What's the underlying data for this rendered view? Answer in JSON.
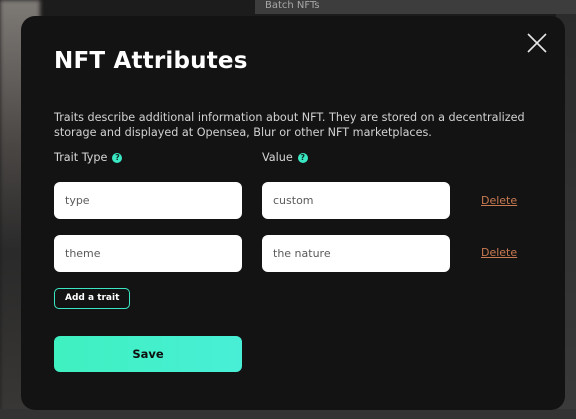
{
  "background": {
    "tab_text": "Batch NFTs"
  },
  "modal": {
    "title": "NFT Attributes",
    "description": "Traits describe additional information about NFT. They are stored on a decentralized storage and displayed at Opensea, Blur or other NFT marketplaces.",
    "trait_type_label": "Trait Type",
    "value_label": "Value",
    "help_icon_glyph": "?",
    "traits": [
      {
        "trait_type": "type",
        "value": "custom",
        "delete_label": "Delete"
      },
      {
        "trait_type": "theme",
        "value": "the nature",
        "delete_label": "Delete"
      }
    ],
    "add_trait_label": "Add a trait",
    "save_label": "Save",
    "icons": {
      "close": "close-icon",
      "help": "help-icon"
    },
    "colors": {
      "accent": "#39e8c2",
      "modal_bg": "#131313",
      "delete_link": "#c87a52"
    }
  }
}
